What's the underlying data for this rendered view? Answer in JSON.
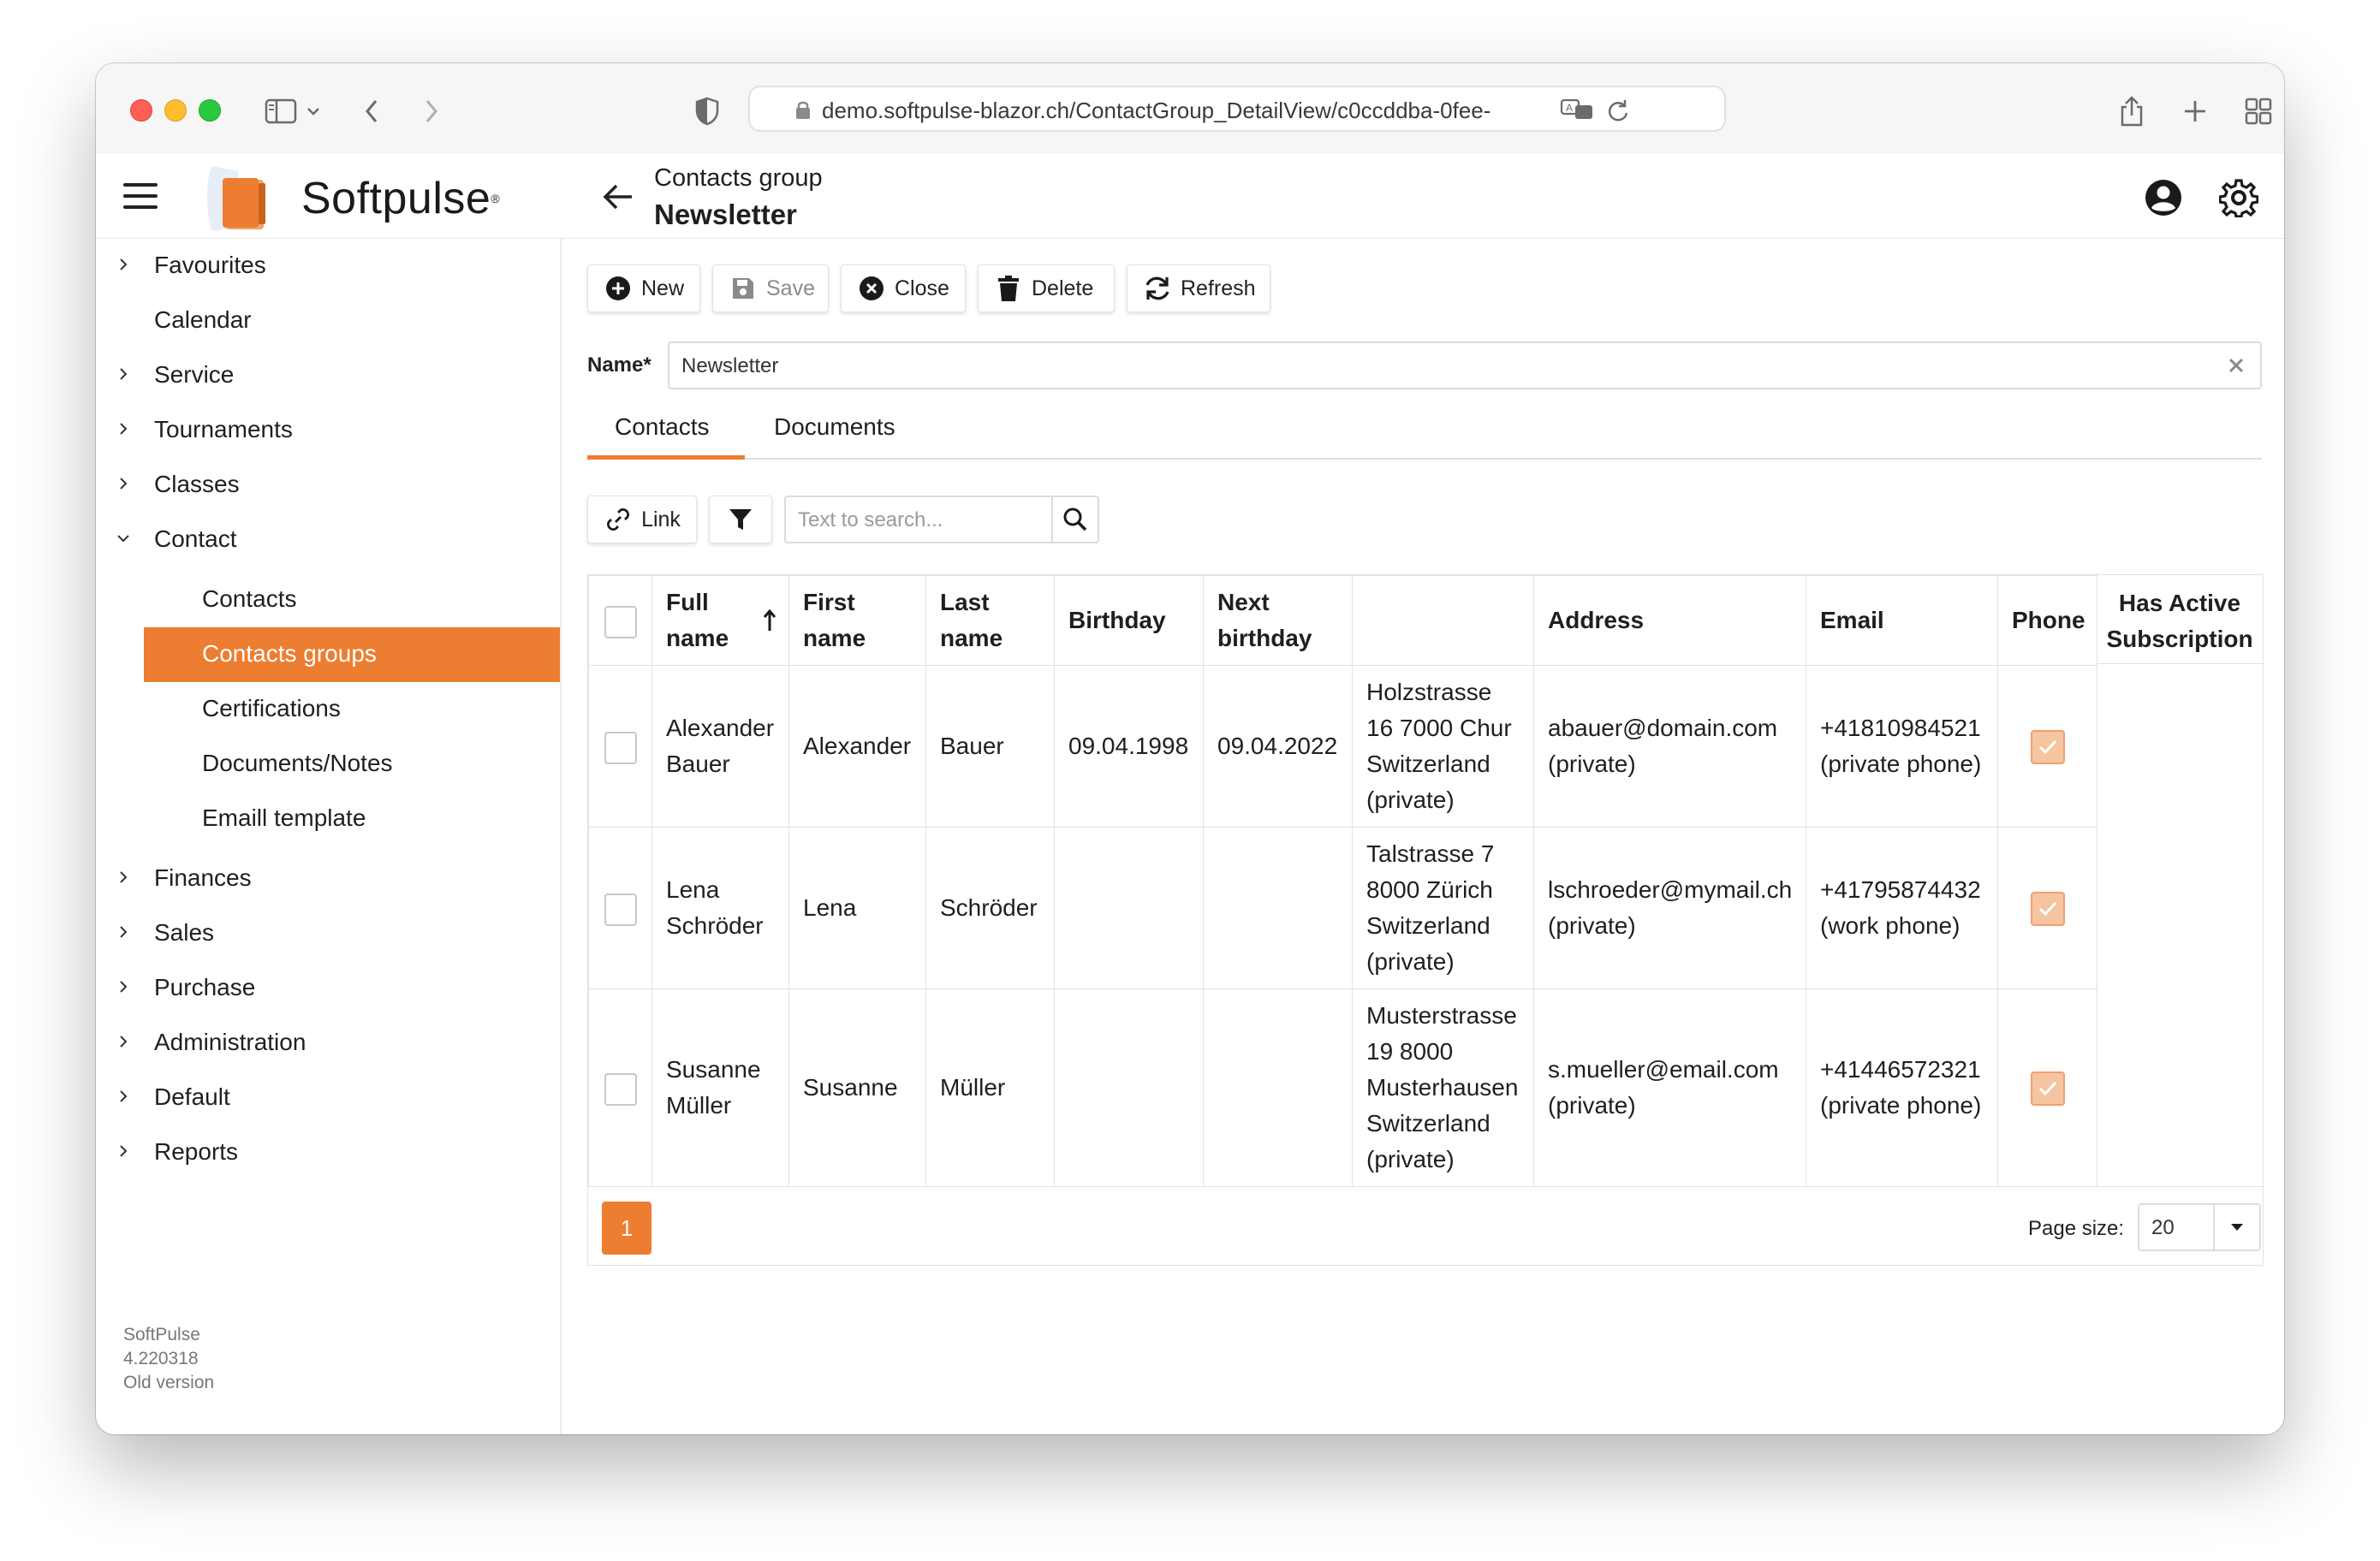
{
  "browser": {
    "url": "demo.softpulse-blazor.ch/ContactGroup_DetailView/c0ccddba-0fee-"
  },
  "header": {
    "brand": "Softpulse",
    "brand_mark": "®",
    "breadcrumb_sub": "Contacts group",
    "breadcrumb_title": "Newsletter"
  },
  "sidebar": {
    "items": [
      {
        "label": "Favourites"
      },
      {
        "label": "Calendar"
      },
      {
        "label": "Service"
      },
      {
        "label": "Tournaments"
      },
      {
        "label": "Classes"
      },
      {
        "label": "Contact"
      },
      {
        "label": "Contacts"
      },
      {
        "label": "Contacts groups"
      },
      {
        "label": "Certifications"
      },
      {
        "label": "Documents/Notes"
      },
      {
        "label": "Emaill template"
      },
      {
        "label": "Finances"
      },
      {
        "label": "Sales"
      },
      {
        "label": "Purchase"
      },
      {
        "label": "Administration"
      },
      {
        "label": "Default"
      },
      {
        "label": "Reports"
      }
    ],
    "version": {
      "app": "SoftPulse",
      "number": "4.220318",
      "note": "Old version"
    }
  },
  "toolbar": {
    "new": "New",
    "save": "Save",
    "close": "Close",
    "delete": "Delete",
    "refresh": "Refresh"
  },
  "form": {
    "name_label": "Name*",
    "name_value": "Newsletter"
  },
  "tabs": {
    "contacts": "Contacts",
    "documents": "Documents"
  },
  "grid_toolbar": {
    "link": "Link",
    "search_placeholder": "Text to search..."
  },
  "grid": {
    "columns": {
      "full_name": "Full name",
      "first_name": "First name",
      "last_name": "Last name",
      "birthday": "Birthday",
      "next_birthday": "Next birthday",
      "unnamed": "",
      "address": "Address",
      "email": "Email",
      "phone": "Phone",
      "has_active_subscription": "Has Active Subscription"
    },
    "rows": [
      {
        "full_name": "Alexander Bauer",
        "first_name": "Alexander",
        "last_name": "Bauer",
        "birthday": "09.04.1998",
        "next_birthday": "09.04.2022",
        "location": "Holzstrasse 16 7000 Chur Switzerland (private)",
        "address": "abauer@domain.com (private)",
        "email": "+41810984521 (private phone)",
        "phone_checked": true
      },
      {
        "full_name": "Lena Schröder",
        "first_name": "Lena",
        "last_name": "Schröder",
        "birthday": "",
        "next_birthday": "",
        "location": "Talstrasse 7 8000 Zürich Switzerland (private)",
        "address": "lschroeder@mymail.ch (private)",
        "email": "+41795874432 (work phone)",
        "phone_checked": true
      },
      {
        "full_name": "Susanne Müller",
        "first_name": "Susanne",
        "last_name": "Müller",
        "birthday": "",
        "next_birthday": "",
        "location": "Musterstrasse 19 8000 Musterhausen Switzerland (private)",
        "address": "s.mueller@email.com (private)",
        "email": "+41446572321 (private phone)",
        "phone_checked": true
      }
    ]
  },
  "pager": {
    "current_page": "1",
    "page_size_label": "Page size:",
    "page_size": "20"
  },
  "colors": {
    "accent": "#ed7d31",
    "checkbox_checked": "#f6c4a0"
  }
}
